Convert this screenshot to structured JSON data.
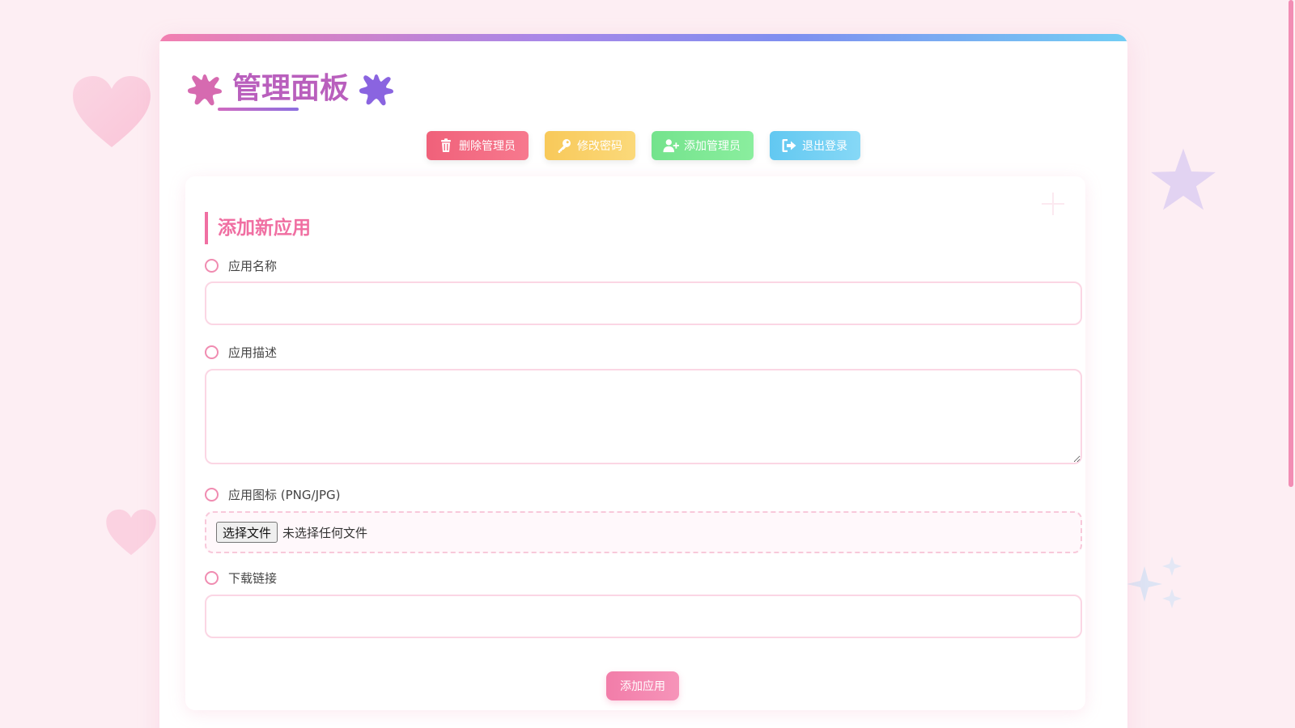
{
  "header": {
    "title": "管理面板",
    "left_icon": "splat-icon",
    "right_icon": "splat-icon"
  },
  "toolbar": {
    "buttons": [
      {
        "label": "删除管理员",
        "icon": "trash-icon",
        "color": "#f0617a"
      },
      {
        "label": "修改密码",
        "icon": "key-icon",
        "color": "#f8c95a"
      },
      {
        "label": "添加管理员",
        "icon": "user-plus-icon",
        "color": "#74e38d"
      },
      {
        "label": "退出登录",
        "icon": "logout-icon",
        "color": "#62c8f1"
      }
    ]
  },
  "form": {
    "section_title": "添加新应用",
    "fields": {
      "name": {
        "label": "应用名称",
        "value": ""
      },
      "description": {
        "label": "应用描述",
        "value": ""
      },
      "icon": {
        "label": "应用图标 (PNG/JPG)",
        "button_label": "选择文件",
        "status": "未选择任何文件"
      },
      "download": {
        "label": "下载链接",
        "value": ""
      }
    },
    "submit_label": "添加应用"
  },
  "colors": {
    "accent_pink": "#f06fa2",
    "title_purple": "#b95fbd",
    "page_background": "#fdeef3"
  }
}
